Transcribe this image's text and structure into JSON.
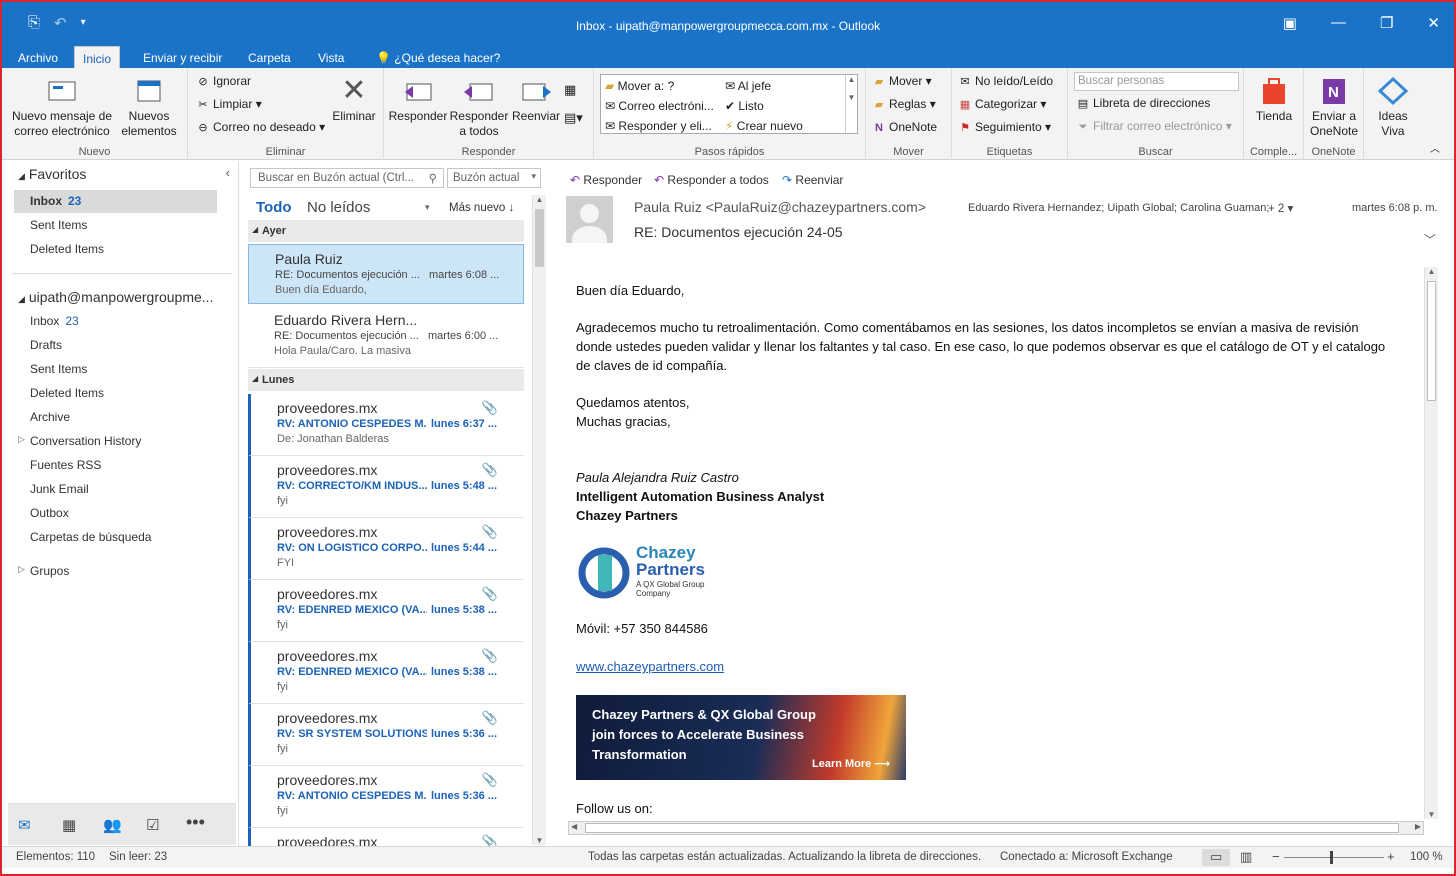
{
  "window": {
    "title": "Inbox - uipath@manpowergroupmecca.com.mx - Outlook"
  },
  "tabs": [
    "Archivo",
    "Inicio",
    "Enviar y recibir",
    "Carpeta",
    "Vista",
    "¿Qué desea hacer?"
  ],
  "ribbon": {
    "nuevo": {
      "new_email": "Nuevo mensaje de correo electrónico",
      "new_items": "Nuevos elementos",
      "label": "Nuevo"
    },
    "eliminar": {
      "ignore": "Ignorar",
      "clean": "Limpiar",
      "junk": "Correo no deseado",
      "delete": "Eliminar",
      "label": "Eliminar"
    },
    "responder": {
      "reply": "Responder",
      "reply_all": "Responder a todos",
      "forward": "Reenviar",
      "label": "Responder"
    },
    "pasos": {
      "move_to": "Mover a: ?",
      "to_boss": "Al jefe",
      "email": "Correo electróni...",
      "done": "Listo",
      "reply_del": "Responder y eli...",
      "create": "Crear nuevo",
      "label": "Pasos rápidos"
    },
    "mover": {
      "move": "Mover",
      "rules": "Reglas",
      "onenote": "OneNote",
      "label": "Mover"
    },
    "etiquetas": {
      "unread": "No leído/Leído",
      "categorize": "Categorizar",
      "followup": "Seguimiento",
      "label": "Etiquetas"
    },
    "buscar": {
      "placeholder": "Buscar personas",
      "address_book": "Libreta de direcciones",
      "filter": "Filtrar correo electrónico",
      "label": "Buscar"
    },
    "store": {
      "label": "Tienda",
      "group": "Comple..."
    },
    "onenote": {
      "label": "Enviar a OneNote",
      "group": "OneNote"
    },
    "ideas": {
      "label": "Ideas Viva"
    }
  },
  "nav": {
    "favorites": "Favoritos",
    "fav_items": [
      {
        "label": "Inbox",
        "count": "23"
      },
      {
        "label": "Sent Items",
        "count": ""
      },
      {
        "label": "Deleted Items",
        "count": ""
      }
    ],
    "account": "uipath@manpowergroupme...",
    "acct_items": [
      {
        "label": "Inbox",
        "count": "23"
      },
      {
        "label": "Drafts",
        "count": ""
      },
      {
        "label": "Sent Items",
        "count": ""
      },
      {
        "label": "Deleted Items",
        "count": ""
      },
      {
        "label": "Archive",
        "count": ""
      },
      {
        "label": "Conversation History",
        "count": ""
      },
      {
        "label": "Fuentes RSS",
        "count": ""
      },
      {
        "label": "Junk Email",
        "count": ""
      },
      {
        "label": "Outbox",
        "count": ""
      },
      {
        "label": "Carpetas de búsqueda",
        "count": ""
      }
    ],
    "groups": "Grupos"
  },
  "list": {
    "search_placeholder": "Buscar en Buzón actual (Ctrl...",
    "scope": "Buzón actual",
    "filter_all": "Todo",
    "filter_unread": "No leídos",
    "sort": "Más nuevo",
    "group_yesterday": "Ayer",
    "group_monday": "Lunes",
    "messages": [
      {
        "from": "Paula Ruiz",
        "subject": "RE: Documentos ejecución ...",
        "time": "martes 6:08 ...",
        "preview": "Buen día Eduardo,"
      },
      {
        "from": "Eduardo Rivera Hern...",
        "subject": "RE: Documentos ejecución ...",
        "time": "martes 6:00 ...",
        "preview": "Hola Paula/Caro.  La masiva"
      },
      {
        "from": "proveedores.mx",
        "subject": "RV: ANTONIO CESPEDES M...",
        "time": "lunes 6:37 ...",
        "preview": "De: Jonathan Balderas"
      },
      {
        "from": "proveedores.mx",
        "subject": "RV: CORRECTO/KM INDUS...",
        "time": "lunes 5:48 ...",
        "preview": "fyi"
      },
      {
        "from": "proveedores.mx",
        "subject": "RV: ON LOGISTICO CORPO...",
        "time": "lunes 5:44 ...",
        "preview": "FYI"
      },
      {
        "from": "proveedores.mx",
        "subject": "RV: EDENRED MEXICO (VA...",
        "time": "lunes 5:38 ...",
        "preview": "fyi"
      },
      {
        "from": "proveedores.mx",
        "subject": "RV: EDENRED MEXICO (VA...",
        "time": "lunes 5:38 ...",
        "preview": "fyi"
      },
      {
        "from": "proveedores.mx",
        "subject": "RV: SR SYSTEM SOLUTIONS...",
        "time": "lunes 5:36 ...",
        "preview": "fyi"
      },
      {
        "from": "proveedores.mx",
        "subject": "RV: ANTONIO CESPEDES M...",
        "time": "lunes 5:36 ...",
        "preview": "fyi"
      },
      {
        "from": "proveedores.mx",
        "subject": "",
        "time": "",
        "preview": ""
      }
    ]
  },
  "reading": {
    "reply": "Responder",
    "reply_all": "Responder a todos",
    "forward": "Reenviar",
    "sender": "Paula Ruiz <PaulaRuiz@chazeypartners.com>",
    "recipients": "Eduardo Rivera Hernandez; Uipath Global; Carolina Guaman;",
    "more": "+ 2",
    "date": "martes 6:08 p. m.",
    "subject": "RE: Documentos ejecución 24-05",
    "greeting": "Buen día Eduardo,",
    "para1_l1": "Agradecemos mucho tu retroalimentación. Como comentábamos en las sesiones, los datos incompletos se envían a masiva de revisión",
    "para1_l2": "donde ustedes pueden validar y llenar los faltantes y tal caso. En ese caso, lo que podemos observar es que el catálogo de OT y el catalogo",
    "para1_l3": "de claves de id compañía.",
    "closing1": "Quedamos atentos,",
    "closing2": "Muchas gracias,",
    "sig_name": "Paula Alejandra Ruiz Castro",
    "sig_title": "Intelligent Automation Business Analyst",
    "sig_company": "Chazey Partners",
    "logo_l1": "Chazey",
    "logo_l2": "Partners",
    "logo_l3": "A QX Global Group",
    "logo_l4": "Company",
    "mobile": "Móvil: +57 350 844586",
    "website": "www.chazeypartners.com",
    "banner_l1": "Chazey Partners & QX Global Group",
    "banner_l2": "join forces to Accelerate Business",
    "banner_l3": "Transformation",
    "banner_cta": "Learn More ⟶",
    "follow": "Follow us on:"
  },
  "status": {
    "items": "Elementos: 110",
    "unread": "Sin leer: 23",
    "sync": "Todas las carpetas están actualizadas.  Actualizando la libreta de direcciones.",
    "connected": "Conectado a: Microsoft Exchange",
    "zoom": "100 %"
  }
}
